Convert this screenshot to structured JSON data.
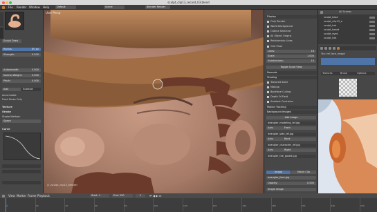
{
  "window": {
    "title": "sculpt_clip13_record_03.blend"
  },
  "header": {
    "menus": [
      "File",
      "Render",
      "Window",
      "Help"
    ],
    "layout": "Default",
    "scene": "Scene",
    "engine": "Blender Render"
  },
  "tools": {
    "brush_name": "Sculpt Draw",
    "radius": {
      "label": "Radius:",
      "value": "80 px"
    },
    "strength": {
      "label": "Strength:",
      "value": "0.500"
    },
    "autosmooth": {
      "label": "Autosmooth:",
      "value": "0.000"
    },
    "normal_weight": {
      "label": "Normal Weight:",
      "value": "0.000"
    },
    "pinch": {
      "label": "Pinch:",
      "value": "0.000"
    },
    "add_label": "Add",
    "sub_label": "Subtract",
    "accumulate": "Accumulate",
    "front_faces": "Front Faces Only",
    "texture": "Texture",
    "stroke": "Stroke",
    "stroke_method": "Stroke Method:",
    "stroke_value": "Space",
    "curve": "Curve"
  },
  "viewport": {
    "mode_label": "User Persp",
    "object_label": "(1) sculpt_clip13_blender"
  },
  "properties": {
    "sections": [
      "Display",
      "Normals",
      "Shading",
      "Add Image"
    ],
    "checks": [
      "Only Render",
      "World Background",
      "Outline Selected",
      "All Object Origins",
      "Relationship Lines"
    ],
    "grid_floor": "Grid Floor",
    "lines": {
      "label": "Lines:",
      "value": "16"
    },
    "scale": {
      "label": "Scale:",
      "value": "1.000"
    },
    "subdivisions": {
      "label": "Subdivisions:",
      "value": "10"
    },
    "toggle_quad": "Toggle Quad View",
    "shading_checks": [
      "Textured Solid",
      "Matcap",
      "Backface Culling",
      "Depth Of Field",
      "Ambient Occlusion"
    ],
    "motion_tracking": "Motion Tracking",
    "background_images": "Background Images",
    "image_a": "wrangler_modeling_ref.jpg",
    "axis_a": {
      "label": "Axis:",
      "value": "Front"
    },
    "image_b": "wrangler_side_ref.jpg",
    "axis_b": {
      "label": "Axis:",
      "value": "Back"
    },
    "image_c": "wrangler_character_ref.jpg",
    "axis_c": {
      "label": "Axis:",
      "value": "Right"
    },
    "image_d": "wrangler_the_posed.jpg",
    "source": {
      "image": "Image",
      "movie": "Movie Clip"
    },
    "image_file": "wrangler_face.jpg",
    "opacity": {
      "label": "Opacity:",
      "value": "0.500"
    },
    "single_image": "Single Image"
  },
  "outliner": {
    "title": "All Scenes",
    "items": [
      "sculpt_base",
      "sculpt_clip13_a",
      "sculpt_hat",
      "sculpt_beard",
      "sculpt_eyes",
      "sculpt_lids"
    ]
  },
  "right_panel": {
    "tabs": [
      "Textures",
      "Brush",
      "Options"
    ],
    "label": "Tex: ref_face_image"
  },
  "timeline": {
    "menus": [
      "View",
      "Marker",
      "Frame",
      "Playback"
    ],
    "start": {
      "label": "Start:",
      "value": "1"
    },
    "end": {
      "label": "End:",
      "value": "250"
    },
    "current": "1",
    "ticks": [
      "0",
      "20",
      "40",
      "60",
      "80",
      "100",
      "120",
      "140",
      "160",
      "180",
      "200",
      "220",
      "240"
    ]
  },
  "colors": {
    "panel": "#474747",
    "accent": "#4f74a8",
    "clay": "#9a6f5a",
    "hair": "#6b3a2a"
  }
}
